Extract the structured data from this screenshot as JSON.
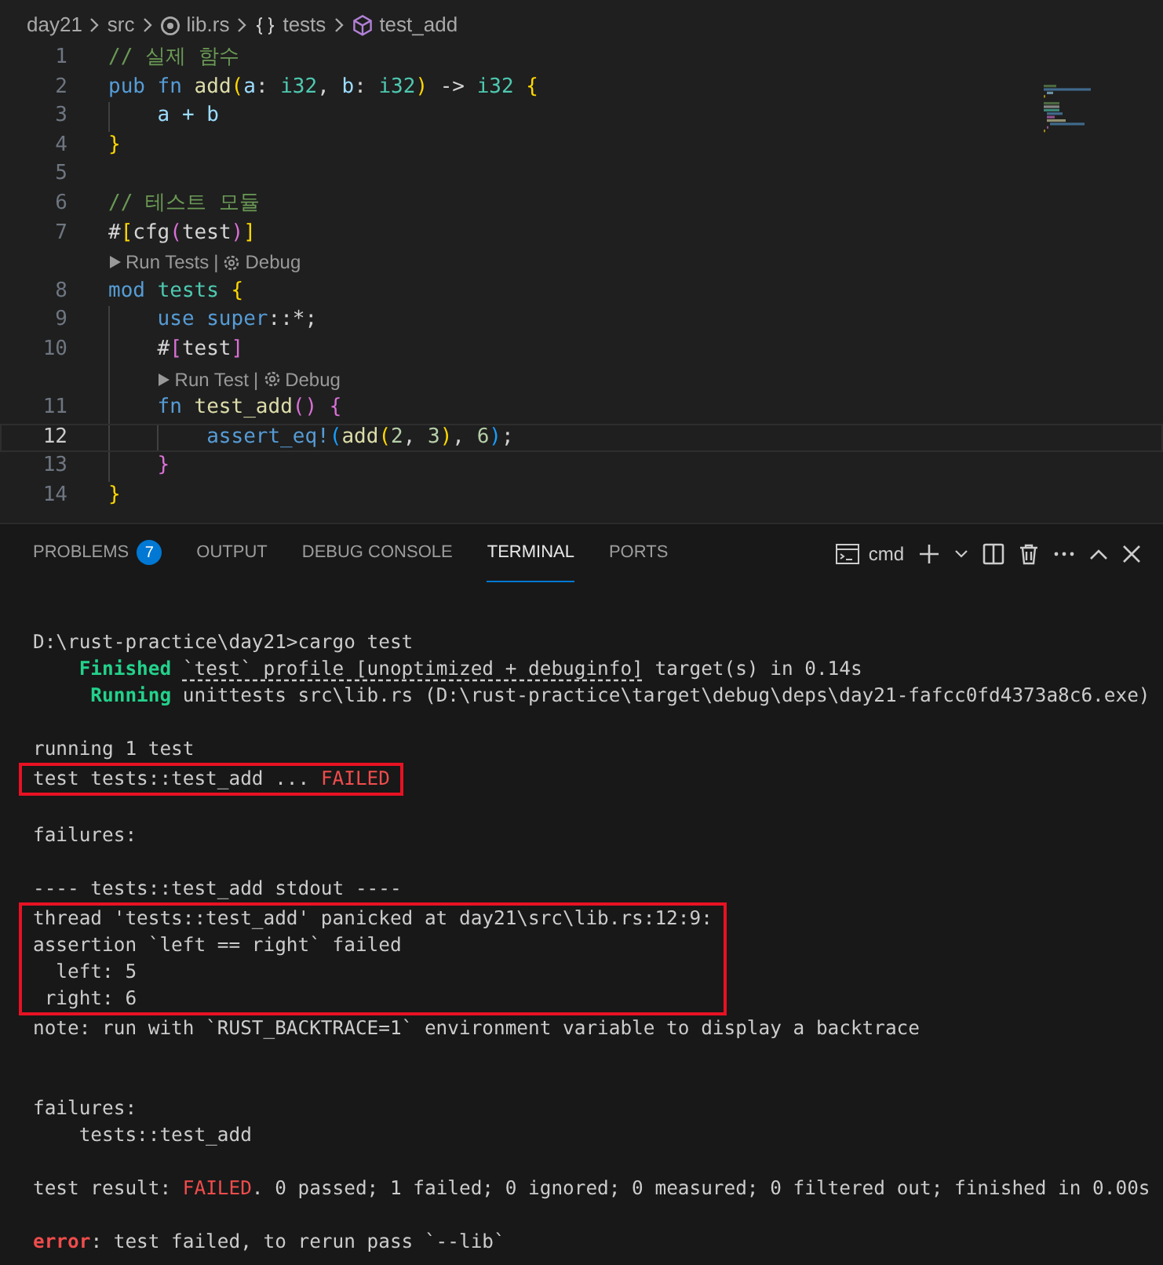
{
  "breadcrumb": [
    {
      "text": "day21",
      "kind": "folder"
    },
    {
      "text": "src",
      "kind": "folder"
    },
    {
      "text": "lib.rs",
      "kind": "file"
    },
    {
      "text": "tests",
      "kind": "module"
    },
    {
      "text": "test_add",
      "kind": "function"
    }
  ],
  "editor": {
    "lines": [
      {
        "kind": "code",
        "number": "1",
        "current": false,
        "tokens": [
          {
            "text": "// 실제 함수",
            "color": "#6a9955"
          }
        ]
      },
      {
        "kind": "code",
        "number": "2",
        "current": false,
        "tokens": [
          {
            "text": "pub fn ",
            "color": "#569cd6"
          },
          {
            "text": "add",
            "color": "#dcdcaa"
          },
          {
            "text": "(",
            "color": "#ffd700"
          },
          {
            "text": "a",
            "color": "#9cdcfe"
          },
          {
            "text": ": ",
            "color": "#d4d4d4"
          },
          {
            "text": "i32",
            "color": "#4ec9b0"
          },
          {
            "text": ", ",
            "color": "#d4d4d4"
          },
          {
            "text": "b",
            "color": "#9cdcfe"
          },
          {
            "text": ": ",
            "color": "#d4d4d4"
          },
          {
            "text": "i32",
            "color": "#4ec9b0"
          },
          {
            "text": ")",
            "color": "#ffd700"
          },
          {
            "text": " -> ",
            "color": "#d4d4d4"
          },
          {
            "text": "i32 ",
            "color": "#4ec9b0"
          },
          {
            "text": "{",
            "color": "#ffd700"
          }
        ],
        "children": [
          {
            "kind": "code",
            "number": "3",
            "current": false,
            "tokens": [
              {
                "text": "a + b",
                "color": "#9cdcfe"
              }
            ]
          }
        ]
      },
      {
        "kind": "code",
        "number": "4",
        "current": false,
        "tokens": [
          {
            "text": "}",
            "color": "#ffd700"
          }
        ]
      },
      {
        "kind": "code",
        "number": "5",
        "current": false
      },
      {
        "kind": "code",
        "number": "6",
        "current": false,
        "tokens": [
          {
            "text": "// 테스트 모듈",
            "color": "#6a9955"
          }
        ]
      },
      {
        "kind": "code",
        "number": "7",
        "current": false,
        "tokens": [
          {
            "text": "#",
            "color": "#d4d4d4"
          },
          {
            "text": "[",
            "color": "#ffd700"
          },
          {
            "text": "cfg",
            "color": "#d4d4d4"
          },
          {
            "text": "(",
            "color": "#da70d6"
          },
          {
            "text": "test",
            "color": "#d4d4d4"
          },
          {
            "text": ")",
            "color": "#da70d6"
          },
          {
            "text": "]",
            "color": "#ffd700"
          }
        ]
      },
      {
        "kind": "lens",
        "run": "Run Tests",
        "separator": "|",
        "debug": "Debug"
      },
      {
        "kind": "code",
        "number": "8",
        "current": false,
        "tokens": [
          {
            "text": "mod ",
            "color": "#569cd6"
          },
          {
            "text": "tests ",
            "color": "#4ec9b0"
          },
          {
            "text": "{",
            "color": "#ffd700"
          }
        ],
        "children": [
          {
            "kind": "code",
            "number": "9",
            "current": false,
            "tokens": [
              {
                "text": "use super",
                "color": "#569cd6"
              },
              {
                "text": "::*;",
                "color": "#d4d4d4"
              }
            ]
          },
          {
            "kind": "code",
            "number": "10",
            "current": false,
            "tokens": [
              {
                "text": "#",
                "color": "#d4d4d4"
              },
              {
                "text": "[",
                "color": "#da70d6"
              },
              {
                "text": "test",
                "color": "#d4d4d4"
              },
              {
                "text": "]",
                "color": "#da70d6"
              }
            ]
          },
          {
            "kind": "lens",
            "run": "Run Test",
            "separator": "|",
            "debug": "Debug"
          },
          {
            "kind": "code",
            "number": "11",
            "current": false,
            "tokens": [
              {
                "text": "fn ",
                "color": "#569cd6"
              },
              {
                "text": "test_add",
                "color": "#dcdcaa"
              },
              {
                "text": "(",
                "color": "#da70d6"
              },
              {
                "text": ") ",
                "color": "#da70d6"
              },
              {
                "text": "{",
                "color": "#da70d6"
              }
            ],
            "children": [
              {
                "kind": "code",
                "number": "12",
                "current": true,
                "tokens": [
                  {
                    "text": "assert_eq!",
                    "color": "#569cd6"
                  },
                  {
                    "text": "(",
                    "color": "#179fff"
                  },
                  {
                    "text": "add",
                    "color": "#dcdcaa"
                  },
                  {
                    "text": "(",
                    "color": "#ffd700"
                  },
                  {
                    "text": "2",
                    "color": "#b5cea8"
                  },
                  {
                    "text": ", ",
                    "color": "#d4d4d4"
                  },
                  {
                    "text": "3",
                    "color": "#b5cea8"
                  },
                  {
                    "text": ")",
                    "color": "#ffd700"
                  },
                  {
                    "text": ", ",
                    "color": "#d4d4d4"
                  },
                  {
                    "text": "6",
                    "color": "#b5cea8"
                  },
                  {
                    "text": ")",
                    "color": "#179fff"
                  },
                  {
                    "text": ";",
                    "color": "#d4d4d4"
                  }
                ]
              }
            ]
          },
          {
            "kind": "code",
            "number": "13",
            "current": false,
            "tokens": [
              {
                "text": "}",
                "color": "#da70d6"
              }
            ]
          }
        ]
      },
      {
        "kind": "code",
        "number": "14",
        "current": false,
        "tokens": [
          {
            "text": "}",
            "color": "#ffd700"
          }
        ]
      }
    ]
  },
  "panel": {
    "tabs": [
      {
        "label": "PROBLEMS",
        "badge": "7",
        "selected": false
      },
      {
        "label": "OUTPUT",
        "selected": false
      },
      {
        "label": "DEBUG CONSOLE",
        "selected": false
      },
      {
        "label": "TERMINAL",
        "selected": true
      },
      {
        "label": "PORTS",
        "selected": false
      }
    ],
    "shell": "cmd"
  },
  "terminal": {
    "blocks": [
      {
        "highlighted": false,
        "lines": [
          {
            "kind": "text",
            "segments": [
              {
                "text": "D:\\rust-practice\\day21>cargo test",
                "kind": "plain",
                "color": "#cccccc"
              }
            ]
          },
          {
            "kind": "text",
            "segments": [
              {
                "text": "    Finished ",
                "kind": "bold",
                "color": "#23d18b"
              },
              {
                "text": "`test` profile [unoptimized + debuginfo]",
                "kind": "underlined",
                "color": "#cccccc"
              },
              {
                "text": " target(s) in 0.14s",
                "kind": "plain",
                "color": "#cccccc"
              }
            ]
          },
          {
            "kind": "text",
            "segments": [
              {
                "text": "     Running",
                "kind": "bold",
                "color": "#23d18b"
              },
              {
                "text": " unittests src\\lib.rs (D:\\rust-practice\\target\\debug\\deps\\day21-fafcc0fd4373a8c6.exe)",
                "kind": "plain",
                "color": "#cccccc"
              }
            ]
          },
          {
            "kind": "blank"
          },
          {
            "kind": "text",
            "segments": [
              {
                "text": "running 1 test",
                "kind": "plain",
                "color": "#cccccc"
              }
            ]
          }
        ]
      },
      {
        "highlighted": true,
        "lines": [
          {
            "kind": "text",
            "segments": [
              {
                "text": "test tests::test_add ... ",
                "kind": "plain",
                "color": "#cccccc"
              },
              {
                "text": "FAILED",
                "kind": "plain",
                "color": "#f14c4c"
              }
            ]
          }
        ]
      },
      {
        "highlighted": false,
        "lines": [
          {
            "kind": "blank"
          },
          {
            "kind": "text",
            "segments": [
              {
                "text": "failures:",
                "kind": "plain",
                "color": "#cccccc"
              }
            ]
          },
          {
            "kind": "blank"
          },
          {
            "kind": "text",
            "segments": [
              {
                "text": "---- tests::test_add stdout ----",
                "kind": "plain",
                "color": "#cccccc"
              }
            ]
          }
        ]
      },
      {
        "highlighted": true,
        "lines": [
          {
            "kind": "text",
            "segments": [
              {
                "text": "thread 'tests::test_add' panicked at day21\\src\\lib.rs:12:9:",
                "kind": "plain",
                "color": "#cccccc"
              }
            ]
          },
          {
            "kind": "text",
            "segments": [
              {
                "text": "assertion `left == right` failed",
                "kind": "plain",
                "color": "#cccccc"
              }
            ]
          },
          {
            "kind": "text",
            "segments": [
              {
                "text": "  left: 5",
                "kind": "plain",
                "color": "#cccccc"
              }
            ]
          },
          {
            "kind": "text",
            "segments": [
              {
                "text": " right: 6",
                "kind": "plain",
                "color": "#cccccc"
              }
            ]
          }
        ]
      },
      {
        "highlighted": false,
        "lines": [
          {
            "kind": "text",
            "segments": [
              {
                "text": "note: run with `RUST_BACKTRACE=1` environment variable to display a backtrace",
                "kind": "plain",
                "color": "#cccccc"
              }
            ]
          },
          {
            "kind": "blank"
          },
          {
            "kind": "blank"
          },
          {
            "kind": "text",
            "segments": [
              {
                "text": "failures:",
                "kind": "plain",
                "color": "#cccccc"
              }
            ]
          },
          {
            "kind": "text",
            "segments": [
              {
                "text": "    tests::test_add",
                "kind": "plain",
                "color": "#cccccc"
              }
            ]
          },
          {
            "kind": "blank"
          },
          {
            "kind": "text",
            "segments": [
              {
                "text": "test result: ",
                "kind": "plain",
                "color": "#cccccc"
              },
              {
                "text": "FAILED",
                "kind": "plain",
                "color": "#f14c4c"
              },
              {
                "text": ". 0 passed; 1 failed; 0 ignored; 0 measured; 0 filtered out; finished in 0.00s",
                "kind": "plain",
                "color": "#cccccc"
              }
            ]
          },
          {
            "kind": "blank"
          },
          {
            "kind": "text",
            "segments": [
              {
                "text": "error",
                "kind": "bold",
                "color": "#f14c4c"
              },
              {
                "text": ": test failed, to rerun pass `--lib`",
                "kind": "plain",
                "color": "#cccccc"
              }
            ]
          }
        ]
      }
    ]
  }
}
